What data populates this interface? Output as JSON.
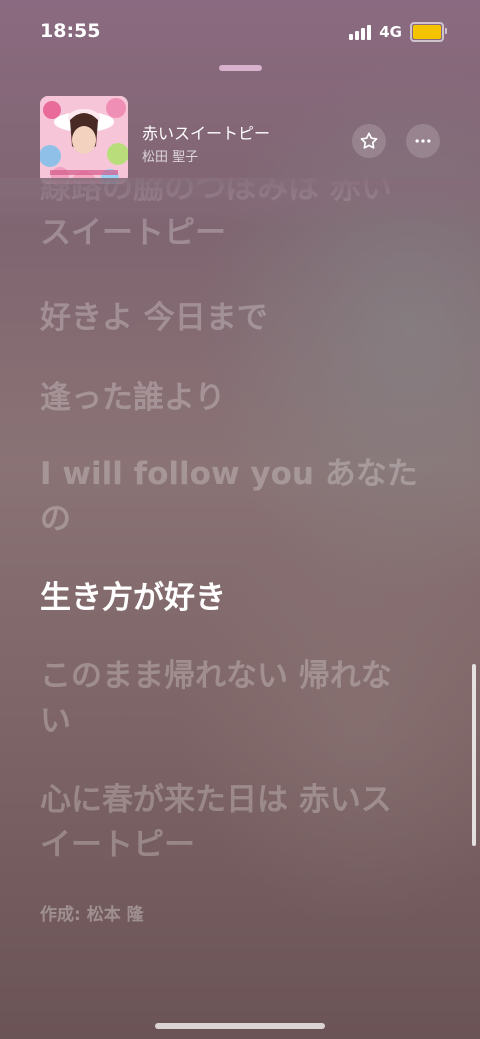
{
  "status_bar": {
    "time": "18:55",
    "network": "4G",
    "battery_color": "#f5c400"
  },
  "now_playing": {
    "title": "赤いスイートピー",
    "artist": "松田 聖子"
  },
  "lyrics": {
    "lines": [
      "線路の脇のつぼみは 赤い\nスイートピー",
      "好きよ 今日まで",
      "逢った誰より",
      "I will follow you あなた\nの",
      "生き方が好き",
      "このまま帰れない 帰れな\nい",
      "心に春が来た日は 赤いス\nイートピー"
    ],
    "active_line_index": 4,
    "credit": "作成: 松本 隆"
  },
  "icons": {
    "favorite": "star-icon",
    "more": "ellipsis-icon"
  },
  "colors": {
    "grabber": "#d8b2cc"
  }
}
